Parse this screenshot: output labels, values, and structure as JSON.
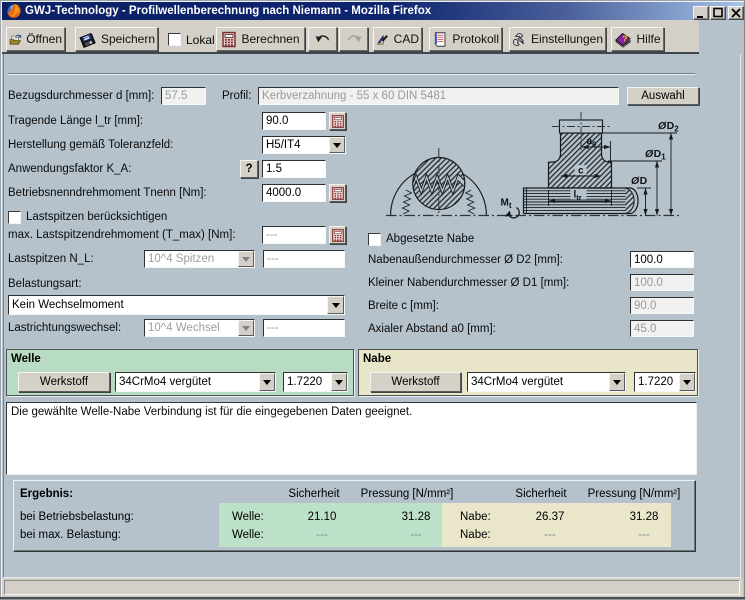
{
  "window": {
    "title": "GWJ-Technology - Profilwellenberechnung nach Niemann - Mozilla Firefox"
  },
  "toolbar": {
    "open": "Öffnen",
    "save": "Speichern",
    "local_checkbox": "Lokal",
    "calculate": "Berechnen",
    "cad": "CAD",
    "protocol": "Protokoll",
    "settings": "Einstellungen",
    "help": "Hilfe"
  },
  "form": {
    "bezugsdurchmesser": {
      "label": "Bezugsdurchmesser d [mm]:",
      "value": "57.5"
    },
    "profil": {
      "label": "Profil:",
      "value": "Kerbverzahnung - 55 x 60 DIN 5481",
      "button": "Auswahl"
    },
    "tragende_laenge": {
      "label": "Tragende Länge l_tr [mm]:",
      "value": "90.0"
    },
    "toleranzfeld": {
      "label": "Herstellung gemäß Toleranzfeld:",
      "value": "H5/IT4"
    },
    "anwendungsfaktor": {
      "label": "Anwendungsfaktor K_A:",
      "value": "1.5",
      "help_button": "?"
    },
    "drehmoment": {
      "label": "Betriebsnenndrehmoment Tnenn [Nm]:",
      "value": "4000.0"
    },
    "lastspitzen_checkbox": "Lastspitzen berücksichtigen",
    "max_lastspitzen": {
      "label": "max. Lastspitzendrehmoment (T_max) [Nm]:",
      "value": "---"
    },
    "lastspitzen_nl": {
      "label": "Lastspitzen N_L:",
      "combo": "10^4 Spitzen",
      "value": "---"
    },
    "belastungsart": {
      "label": "Belastungsart:",
      "value": "Kein Wechselmoment"
    },
    "lastrichtungswechsel": {
      "label": "Lastrichtungswechsel:",
      "combo": "10^4 Wechsel",
      "value": "---"
    },
    "abgesetzte_nabe_checkbox": "Abgesetzte Nabe",
    "d2": {
      "label": "Nabenaußendurchmesser Ø D2 [mm]:",
      "value": "100.0"
    },
    "d1": {
      "label": "Kleiner Nabendurchmesser Ø D1 [mm]:",
      "value": "100.0"
    },
    "breite": {
      "label": "Breite c [mm]:",
      "value": "90.0"
    },
    "abstand": {
      "label": "Axialer Abstand a0 [mm]:",
      "value": "45.0"
    }
  },
  "drawing": {
    "d2_sym": "Ø",
    "d2_main": "D",
    "d2_sub": "2",
    "d1_sym": "Ø",
    "d1_main": "D",
    "d1_sub": "1",
    "d_sym": "Ø",
    "d_main": "D",
    "a0_main": "a",
    "a0_sub": "0",
    "c_label": "c",
    "ltr_main": "l",
    "ltr_sub": "tr",
    "mt_main": "M",
    "mt_sub": "t"
  },
  "welle": {
    "title": "Welle",
    "werkstoff_button": "Werkstoff",
    "material": "34CrMo4 vergütet",
    "number": "1.7220"
  },
  "nabe": {
    "title": "Nabe",
    "werkstoff_button": "Werkstoff",
    "material": "34CrMo4 vergütet",
    "number": "1.7220"
  },
  "message": "Die gewählte Welle-Nabe Verbindung ist für die eingegebenen Daten geeignet.",
  "results": {
    "title": "Ergebnis:",
    "col_sicherheit": "Sicherheit",
    "col_pressung": "Pressung [N/mm²]",
    "row1_label": "bei Betriebsbelastung:",
    "row2_label": "bei max. Belastung:",
    "welle_label": "Welle:",
    "nabe_label": "Nabe:",
    "welle_row1": [
      "21.10",
      "31.28"
    ],
    "welle_row2": [
      "---",
      "---"
    ],
    "nabe_row1": [
      "26.37",
      "31.28"
    ],
    "nabe_row2": [
      "---",
      "---"
    ]
  },
  "colors": {
    "titlebar_left": "#0c2167",
    "titlebar_right": "#a5c2e8",
    "chrome": "#d4d0c8",
    "content_bg": "#b5c2cc",
    "welle_panel": "#b8dcc3",
    "nabe_panel": "#e8e5c8",
    "welle_cell": "#bce0c8",
    "nabe_cell": "#eae6ca"
  }
}
